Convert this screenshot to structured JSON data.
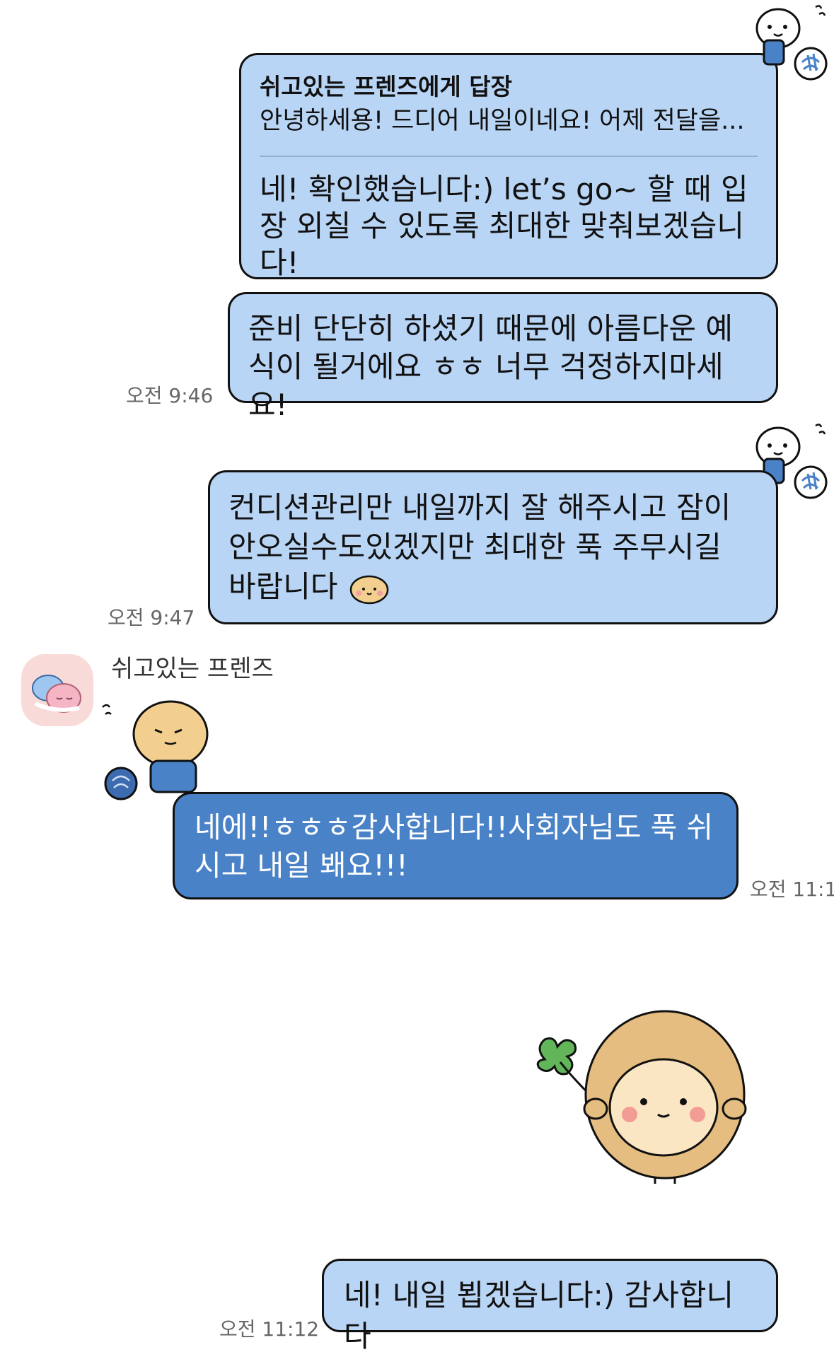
{
  "messages": {
    "m1": {
      "reply_to_label": "쉬고있는 프렌즈에게 답장",
      "reply_preview": "안녕하세용! 드디어 내일이네요! 어제 전달을...",
      "text": "네! 확인했습니다:) let’s go~ 할 때 입장 외칠 수 있도록 최대한 맞춰보겠습니다!"
    },
    "m2": {
      "text": "준비 단단히 하셨기 때문에 아름다운 예식이 될거에요 ㅎㅎ 너무 걱정하지마세요!",
      "time": "오전 9:46"
    },
    "m3": {
      "text": "컨디션관리만 내일까지 잘 해주시고 잠이 안오실수도있겠지만 최대한 푹 주무시길 바랍니다",
      "time": "오전 9:47"
    },
    "m4": {
      "sender": "쉬고있는 프렌즈",
      "text": "네에!!ㅎㅎㅎ감사합니다!!사회자님도 푹 쉬시고 내일 봬요!!!",
      "time": "오전 11:1"
    },
    "m5": {
      "text": "네! 내일 뵙겠습니다:) 감사합니다",
      "time": "오전 11:12"
    }
  },
  "icons": {
    "avatar": "friends-avatar-icon",
    "sticker_bear": "bear-knitting-sticker",
    "sticker_emoji": "smile-face-icon",
    "sticker_big": "potato-clover-sticker"
  },
  "colors": {
    "my_bubble": "#b9d5f5",
    "their_bubble": "#4a82c8",
    "border": "#111111"
  }
}
